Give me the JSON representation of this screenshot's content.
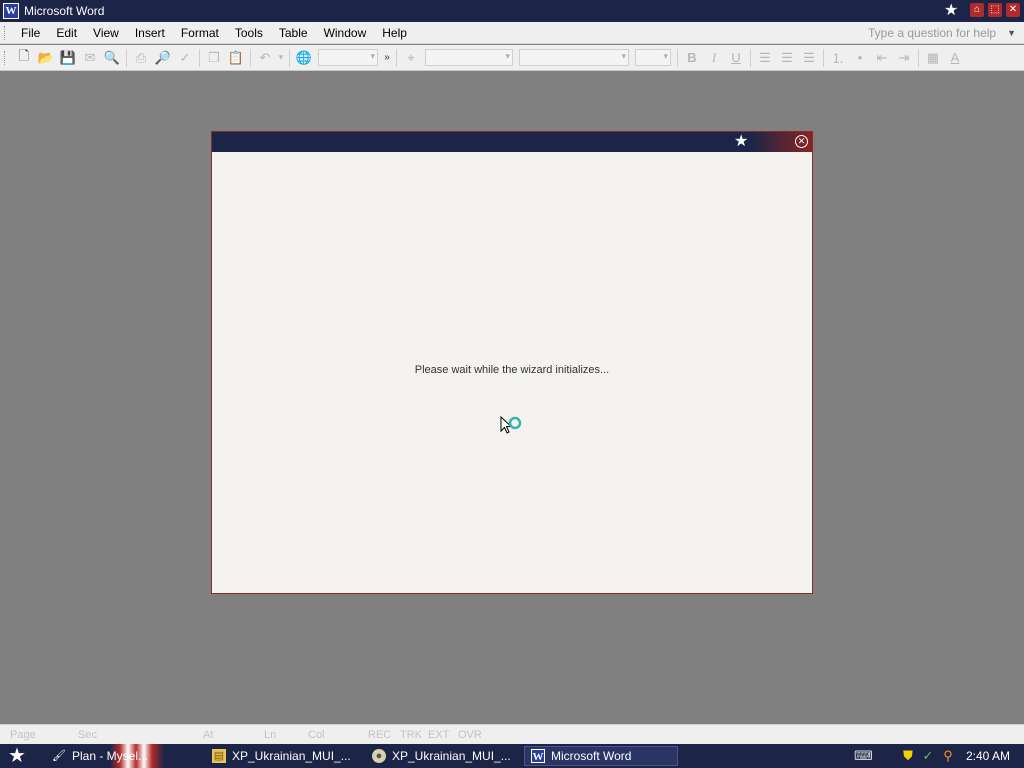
{
  "window": {
    "title": "Microsoft Word",
    "app_icon": "W"
  },
  "menu": {
    "items": [
      {
        "label": "File"
      },
      {
        "label": "Edit"
      },
      {
        "label": "View"
      },
      {
        "label": "Insert"
      },
      {
        "label": "Format"
      },
      {
        "label": "Tools"
      },
      {
        "label": "Table"
      },
      {
        "label": "Window"
      },
      {
        "label": "Help"
      }
    ],
    "help_placeholder": "Type a question for help"
  },
  "toolbar": {
    "bold": "B",
    "italic": "I",
    "underline": "U",
    "font_color": "A"
  },
  "dialog": {
    "message": "Please wait while the wizard initializes..."
  },
  "statusbar": {
    "page": "Page",
    "sec": "Sec",
    "at": "At",
    "ln": "Ln",
    "col": "Col",
    "rec": "REC",
    "trk": "TRK",
    "ext": "EXT",
    "ovr": "OVR"
  },
  "taskbar": {
    "start_task": "Plan - Mysel...",
    "tasks": [
      {
        "label": "XP_Ukrainian_MUI_...",
        "icon": "folder-icon"
      },
      {
        "label": "XP_Ukrainian_MUI_...",
        "icon": "setup-icon"
      },
      {
        "label": "Microsoft Word",
        "icon": "word-icon"
      }
    ],
    "clock": "2:40 AM"
  },
  "colors": {
    "titlebar": "#1c2547",
    "accent_red": "#b02a2a",
    "desktop": "#808080"
  }
}
